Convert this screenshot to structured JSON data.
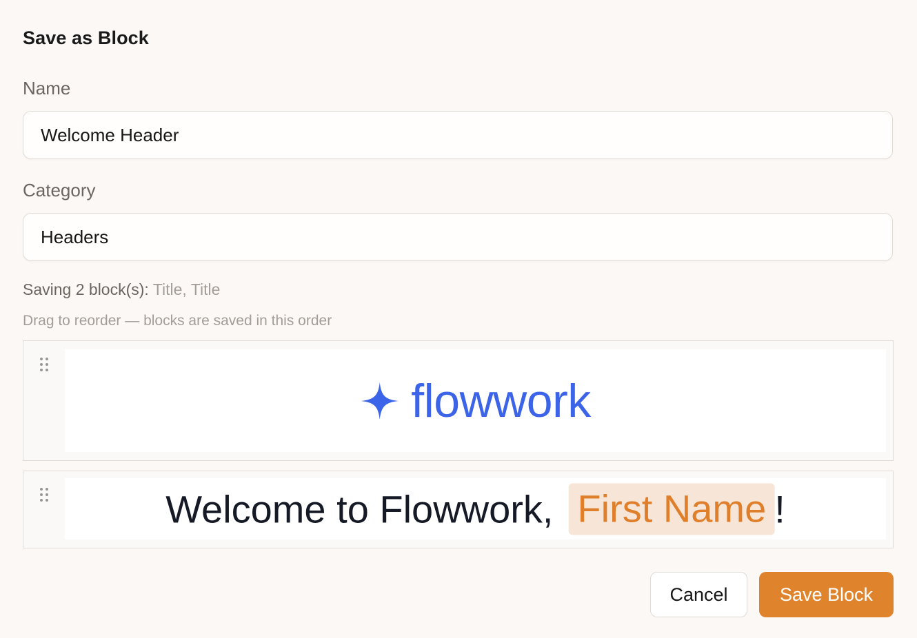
{
  "dialog": {
    "title": "Save as Block"
  },
  "name_field": {
    "label": "Name",
    "value": "Welcome Header"
  },
  "category_field": {
    "label": "Category",
    "value": "Headers"
  },
  "saving": {
    "prefix": "Saving 2 block(s):",
    "names": "Title, Title"
  },
  "hint": "Drag to reorder — blocks are saved in this order",
  "blocks": [
    {
      "logo_icon": "four-point-star-icon",
      "logo_text": "flowwork"
    },
    {
      "text_before": "Welcome to Flowwork,",
      "merge_tag": "First Name",
      "text_after": "!"
    }
  ],
  "actions": {
    "cancel_label": "Cancel",
    "save_label": "Save Block"
  },
  "colors": {
    "accent": "#df842c",
    "brand_blue": "#3c64e8",
    "merge_tag_bg": "#f7e6d7",
    "merge_tag_text": "#df7f2b"
  }
}
